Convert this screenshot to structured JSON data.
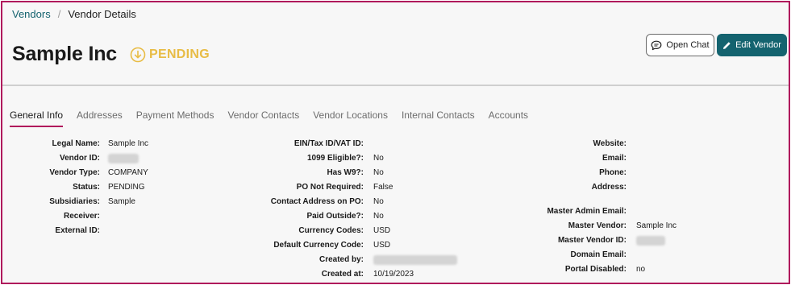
{
  "breadcrumb": {
    "root": "Vendors",
    "separator": "/",
    "current": "Vendor Details"
  },
  "header": {
    "title": "Sample Inc",
    "status": "PENDING",
    "status_color": "#e8bc45"
  },
  "actions": {
    "open_chat": "Open Chat",
    "edit_vendor": "Edit Vendor",
    "primary_color": "#14636f"
  },
  "tabs": [
    {
      "label": "General Info",
      "active": true
    },
    {
      "label": "Addresses"
    },
    {
      "label": "Payment Methods"
    },
    {
      "label": "Vendor Contacts"
    },
    {
      "label": "Vendor Locations"
    },
    {
      "label": "Internal Contacts"
    },
    {
      "label": "Accounts"
    }
  ],
  "general": {
    "col1": [
      {
        "label": "Legal Name:",
        "value": "Sample Inc"
      },
      {
        "label": "Vendor ID:",
        "value": ""
      },
      {
        "label": "Vendor Type:",
        "value": "COMPANY"
      },
      {
        "label": "Status:",
        "value": "PENDING"
      },
      {
        "label": "Subsidiaries:",
        "value": "Sample"
      },
      {
        "label": "Receiver:",
        "value": ""
      },
      {
        "label": "External ID:",
        "value": ""
      }
    ],
    "col2": [
      {
        "label": "EIN/Tax ID/VAT ID:",
        "value": ""
      },
      {
        "label": "1099 Eligible?:",
        "value": "No"
      },
      {
        "label": "Has W9?:",
        "value": "No"
      },
      {
        "label": "PO Not Required:",
        "value": "False"
      },
      {
        "label": "Contact Address on PO:",
        "value": "No"
      },
      {
        "label": "Paid Outside?:",
        "value": "No"
      },
      {
        "label": "Currency Codes:",
        "value": "USD"
      },
      {
        "label": "Default Currency Code:",
        "value": "USD"
      },
      {
        "label": "Created by:",
        "value": ""
      },
      {
        "label": "Created at:",
        "value": "10/19/2023"
      }
    ],
    "col3": [
      {
        "label": "Website:",
        "value": ""
      },
      {
        "label": "Email:",
        "value": ""
      },
      {
        "label": "Phone:",
        "value": ""
      },
      {
        "label": "Address:",
        "value": ""
      },
      {
        "label": "Master Admin Email:",
        "value": ""
      },
      {
        "label": "Master Vendor:",
        "value": "Sample Inc"
      },
      {
        "label": "Master Vendor ID:",
        "value": ""
      },
      {
        "label": "Domain Email:",
        "value": ""
      },
      {
        "label": "Portal Disabled:",
        "value": "no"
      }
    ]
  }
}
